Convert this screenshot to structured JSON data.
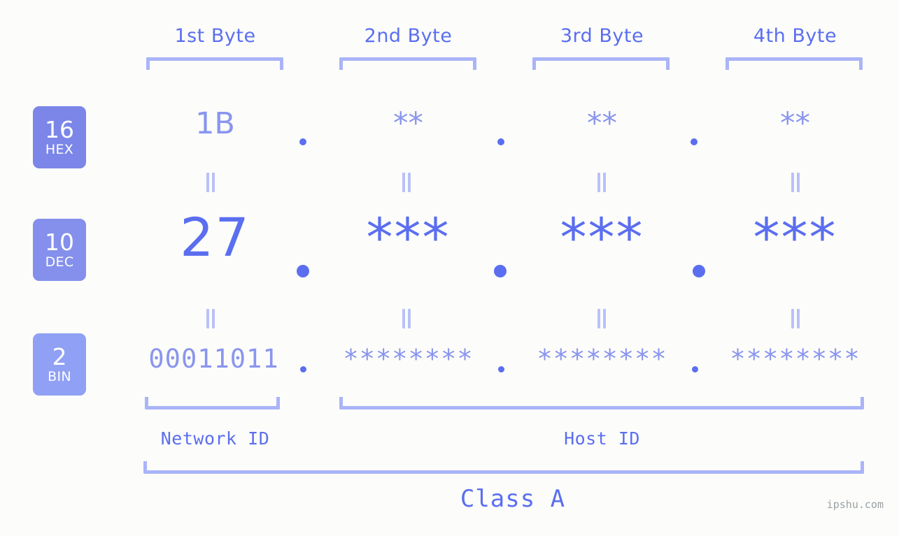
{
  "page": {
    "background_color": "#fcfdfa",
    "accent_strong": "#5b6ef0",
    "accent_light": "#8a95ef",
    "accent_bracket": "#aab4f8",
    "watermark": "ipshu.com"
  },
  "byte_headers": [
    {
      "label": "1st Byte"
    },
    {
      "label": "2nd Byte"
    },
    {
      "label": "3rd Byte"
    },
    {
      "label": "4th Byte"
    }
  ],
  "bases": [
    {
      "number": "16",
      "name": "HEX",
      "color": "#7b86e8"
    },
    {
      "number": "10",
      "name": "DEC",
      "color": "#8490ec"
    },
    {
      "number": "2",
      "name": "BIN",
      "color": "#90a0f4"
    }
  ],
  "rows": {
    "hex": {
      "base_number": "16",
      "base_name": "HEX",
      "values": [
        "1B",
        "**",
        "**",
        "**"
      ],
      "separators": [
        ".",
        ".",
        "."
      ]
    },
    "dec": {
      "base_number": "10",
      "base_name": "DEC",
      "values": [
        "27",
        "***",
        "***",
        "***"
      ],
      "separators": [
        ".",
        ".",
        "."
      ]
    },
    "bin": {
      "base_number": "2",
      "base_name": "BIN",
      "values": [
        "00011011",
        "********",
        "********",
        "********"
      ],
      "separators": [
        ".",
        ".",
        "."
      ]
    }
  },
  "equal_markers": {
    "symbol": "=",
    "count_per_row_gap": 4
  },
  "sections": [
    {
      "label": "Network ID"
    },
    {
      "label": "Host ID"
    }
  ],
  "class": {
    "label": "Class A"
  }
}
